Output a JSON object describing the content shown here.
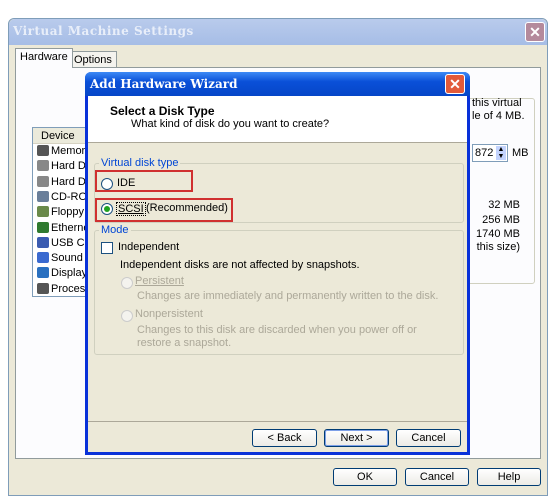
{
  "vm_window": {
    "title": "Virtual Machine Settings",
    "tabs": [
      "Hardware",
      "Options"
    ],
    "device_header": "Device",
    "devices": [
      {
        "label": "Memory",
        "icon": "memory-icon",
        "color": "#555"
      },
      {
        "label": "Hard Disk",
        "icon": "hard-disk-icon",
        "color": "#888"
      },
      {
        "label": "Hard Disk",
        "icon": "hard-disk-icon",
        "color": "#888"
      },
      {
        "label": "CD-ROM",
        "icon": "cdrom-icon",
        "color": "#6a7f9a"
      },
      {
        "label": "Floppy",
        "icon": "floppy-icon",
        "color": "#6a8a4a"
      },
      {
        "label": "Ethernet",
        "icon": "ethernet-icon",
        "color": "#2f7a2f"
      },
      {
        "label": "USB Con",
        "icon": "usb-icon",
        "color": "#3a5bb0"
      },
      {
        "label": "Sound Ac",
        "icon": "sound-icon",
        "color": "#3a6ad0"
      },
      {
        "label": "Display",
        "icon": "display-icon",
        "color": "#2a70c0"
      },
      {
        "label": "Processo",
        "icon": "processor-icon",
        "color": "#555"
      }
    ],
    "right": {
      "line1": "this virtual",
      "line2": "le of 4 MB.",
      "memory_value": "872",
      "unit": "MB",
      "v1": "32 MB",
      "v2": "256 MB",
      "v3": "1740 MB",
      "v4": "this size)"
    },
    "buttons": {
      "ok": "OK",
      "cancel": "Cancel",
      "help": "Help"
    }
  },
  "wizard": {
    "title": "Add Hardware Wizard",
    "heading": "Select a Disk Type",
    "subheading": "What kind of disk do you want to create?",
    "disk_type_group": "Virtual disk type",
    "ide": "IDE",
    "scsi": "SCSI",
    "scsi_note": "(Recommended)",
    "selected": "SCSI",
    "mode_group": "Mode",
    "independent": "Independent",
    "independent_checked": false,
    "independent_desc": "Independent disks are not affected by snapshots.",
    "persistent": "Persistent",
    "persistent_desc": "Changes are immediately and permanently written to the disk.",
    "nonpersistent": "Nonpersistent",
    "nonpersistent_desc": "Changes to this disk are discarded when you power off or restore a snapshot.",
    "buttons": {
      "back": "< Back",
      "next": "Next >",
      "cancel": "Cancel"
    }
  },
  "colors": {
    "highlight": "#d03030",
    "wizard_title": "#0a50d8"
  }
}
